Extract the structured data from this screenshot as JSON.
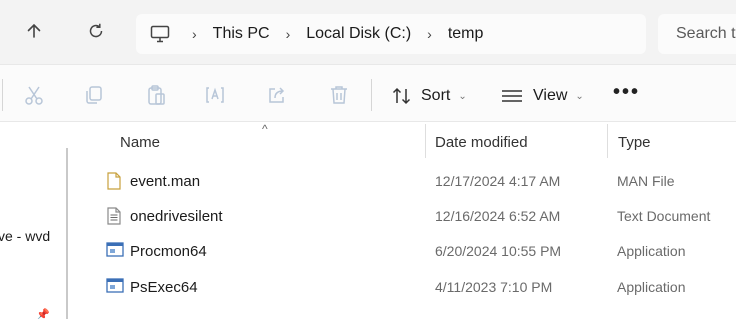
{
  "address": {
    "crumbs": [
      "This PC",
      "Local Disk (C:)",
      "temp"
    ],
    "search_placeholder": "Search t"
  },
  "toolbar": {
    "sort_label": "Sort",
    "view_label": "View",
    "more_label": "•••"
  },
  "nav": {
    "partial_item": "ve - wvd"
  },
  "columns": {
    "name": "Name",
    "date": "Date modified",
    "type": "Type"
  },
  "files": [
    {
      "name": "event.man",
      "date": "12/17/2024 4:17 AM",
      "type": "MAN File",
      "icon": "blank-file-icon"
    },
    {
      "name": "onedrivesilent",
      "date": "12/16/2024 6:52 AM",
      "type": "Text Document",
      "icon": "text-file-icon"
    },
    {
      "name": "Procmon64",
      "date": "6/20/2024 10:55 PM",
      "type": "Application",
      "icon": "application-icon"
    },
    {
      "name": "PsExec64",
      "date": "4/11/2023 7:10 PM",
      "type": "Application",
      "icon": "application-icon"
    }
  ]
}
